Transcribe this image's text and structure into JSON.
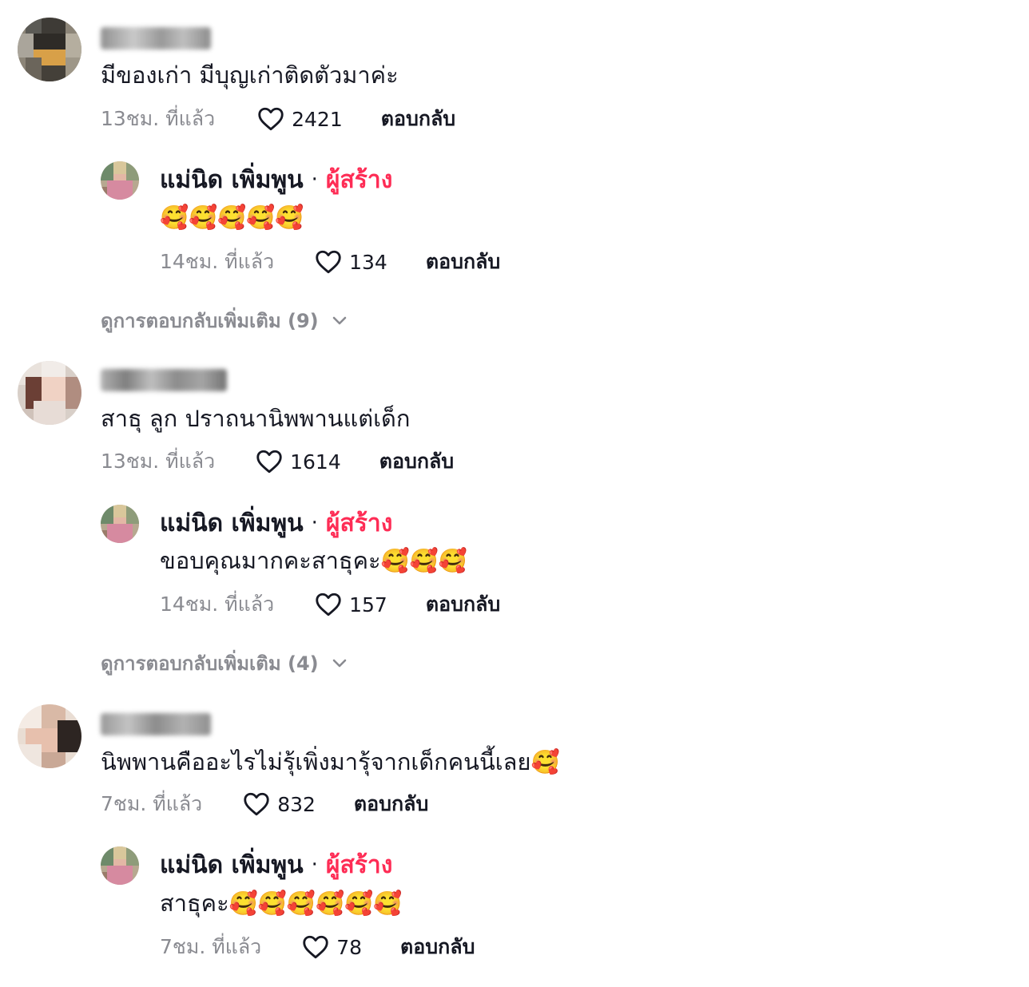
{
  "threads": [
    {
      "comment": {
        "username": "",
        "text": "มีของเก่า มีบุญเก่าติดตัวมาค่ะ",
        "time": "13ชม. ที่แล้ว",
        "likes": "2421",
        "reply_label": "ตอบกลับ"
      },
      "creator_reply": {
        "name": "แม่นิด เพิ่มพูน",
        "separator": "·",
        "tag": "ผู้สร้าง",
        "text": "🥰🥰🥰🥰🥰",
        "time": "14ชม. ที่แล้ว",
        "likes": "134",
        "reply_label": "ตอบกลับ"
      },
      "more_replies": "ดูการตอบกลับเพิ่มเติม (9)"
    },
    {
      "comment": {
        "username": "",
        "text": "สาธุ ลูก ปราถนานิพพานแต่เด็ก",
        "time": "13ชม. ที่แล้ว",
        "likes": "1614",
        "reply_label": "ตอบกลับ"
      },
      "creator_reply": {
        "name": "แม่นิด เพิ่มพูน",
        "separator": "·",
        "tag": "ผู้สร้าง",
        "text": "ขอบคุณมากคะสาธุคะ🥰🥰🥰",
        "time": "14ชม. ที่แล้ว",
        "likes": "157",
        "reply_label": "ตอบกลับ"
      },
      "more_replies": "ดูการตอบกลับเพิ่มเติม (4)"
    },
    {
      "comment": {
        "username": "",
        "text": "นิพพานคืออะไรไม่รุ้เพิ่งมารุ้จากเด็กคนนี้เลย🥰",
        "time": "7ชม. ที่แล้ว",
        "likes": "832",
        "reply_label": "ตอบกลับ"
      },
      "creator_reply": {
        "name": "แม่นิด เพิ่มพูน",
        "separator": "·",
        "tag": "ผู้สร้าง",
        "text": "สาธุคะ🥰🥰🥰🥰🥰🥰",
        "time": "7ชม. ที่แล้ว",
        "likes": "78",
        "reply_label": "ตอบกลับ"
      }
    }
  ],
  "colors": {
    "text": "#161823",
    "muted": "#8a8b91",
    "creator_tag": "#fe2c55"
  },
  "icons": {
    "like": "heart-outline-icon",
    "expand": "chevron-down-icon"
  }
}
